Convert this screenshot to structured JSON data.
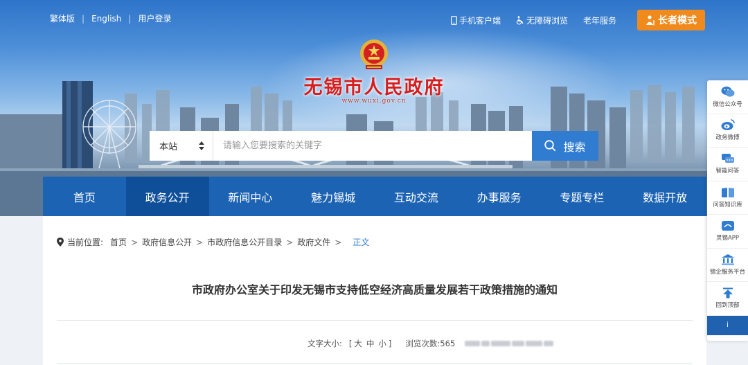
{
  "topbar": {
    "links": [
      "繁体版",
      "English",
      "用户登录"
    ],
    "mobile": "手机客户端",
    "accessible": "无障碍浏览",
    "senior": "老年服务",
    "elder_mode": "长者模式"
  },
  "header": {
    "title": "无锡市人民政府",
    "url": "www.wuxi.gov.cn"
  },
  "search": {
    "scope": "本站",
    "placeholder": "请输入您要搜索的关键字",
    "button": "搜索"
  },
  "nav": {
    "items": [
      "首页",
      "政务公开",
      "新闻中心",
      "魅力锡城",
      "互动交流",
      "办事服务",
      "专题专栏",
      "数据开放"
    ],
    "active_index": 1
  },
  "breadcrumb": {
    "label": "当前位置:",
    "items": [
      "首页",
      "政府信息公开",
      "市政府信息公开目录",
      "政府文件"
    ],
    "current": "正文"
  },
  "article": {
    "title": "市政府办公室关于印发无锡市支持低空经济高质量发展若干政策措施的通知",
    "font_label": "文字大小:",
    "font_sizes": [
      "大",
      "中",
      "小"
    ],
    "views_label": "浏览次数:",
    "views": "565"
  },
  "sidebar": {
    "items": [
      "微信公众号",
      "政务微博",
      "智能问答",
      "问答知识库",
      "灵锡APP",
      "锡企服务平台",
      "回到顶部"
    ],
    "bottom": "i"
  },
  "colors": {
    "nav_bg": "#1c63b4",
    "nav_active": "#0f4f99",
    "search_button": "#2f7cd1",
    "elder_button": "#f08a1c",
    "title_red": "#d71d1d"
  }
}
